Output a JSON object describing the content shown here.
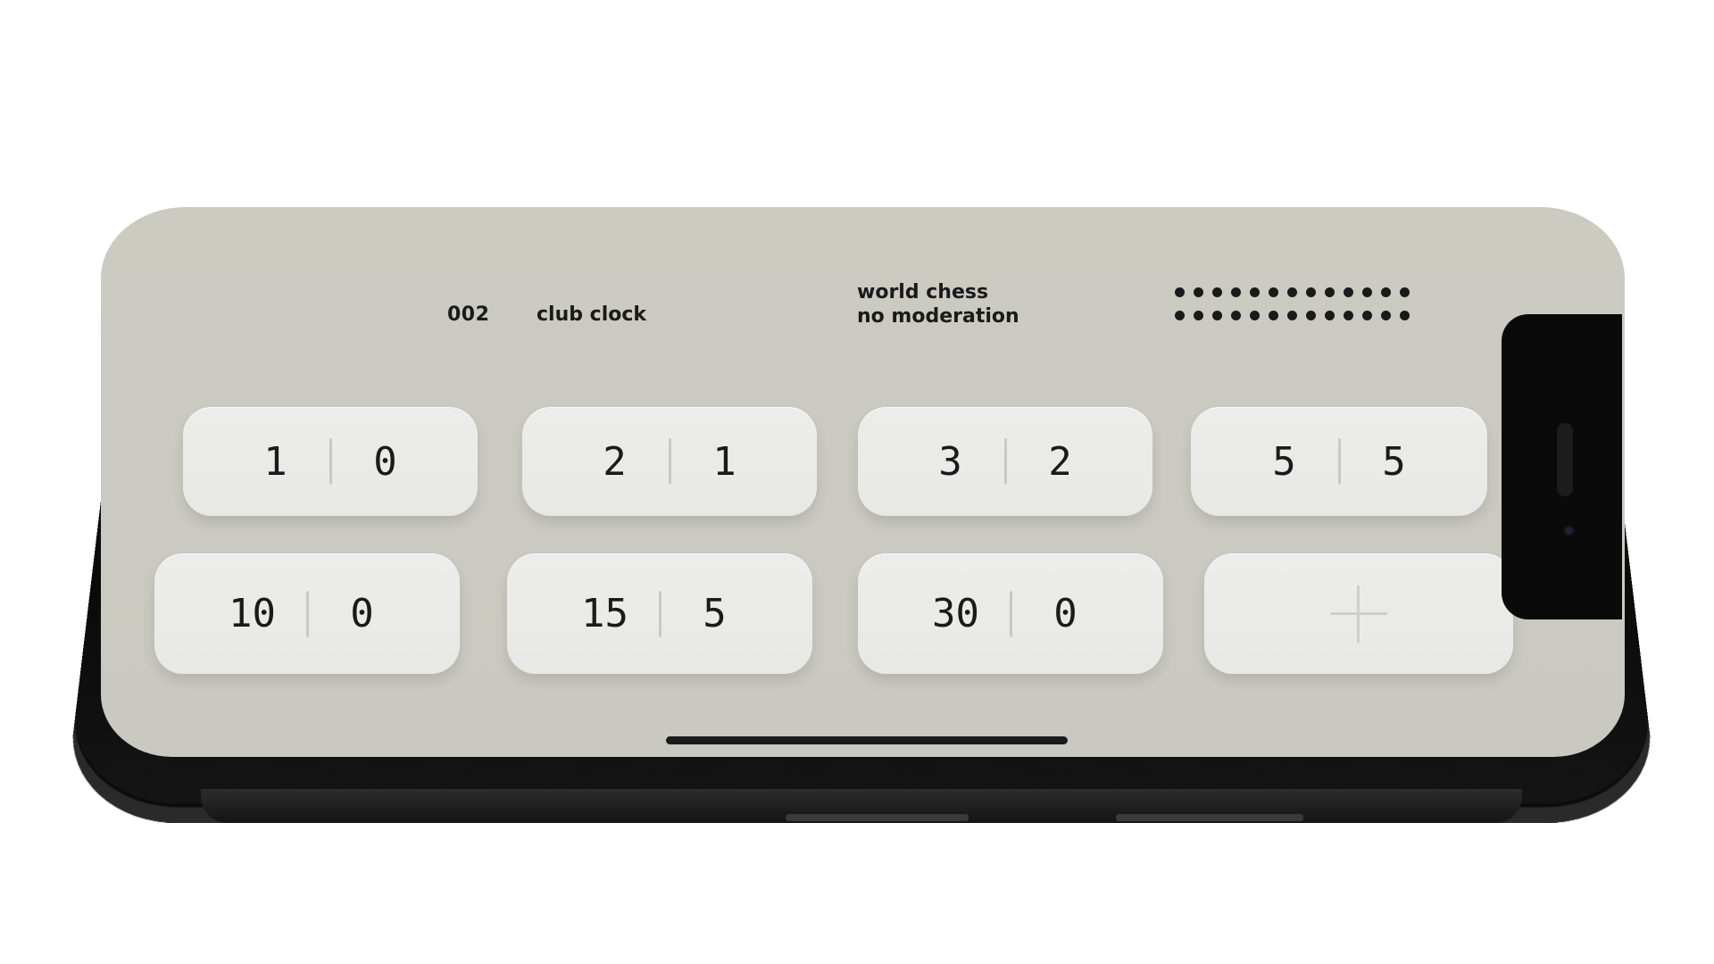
{
  "header": {
    "number": "002",
    "title": "club clock",
    "subtitle_line1": "world chess",
    "subtitle_line2": "no moderation"
  },
  "presets": [
    {
      "minutes": "1",
      "increment": "0"
    },
    {
      "minutes": "2",
      "increment": "1"
    },
    {
      "minutes": "3",
      "increment": "2"
    },
    {
      "minutes": "5",
      "increment": "5"
    },
    {
      "minutes": "10",
      "increment": "0"
    },
    {
      "minutes": "15",
      "increment": "5"
    },
    {
      "minutes": "30",
      "increment": "0"
    }
  ],
  "add_preset": {
    "icon": "plus-icon"
  },
  "colors": {
    "screen_bg": "#cbcbc2",
    "button_bg": "#ebebe8",
    "text": "#1a1a1a",
    "phone_body": "#0a0a0a"
  }
}
